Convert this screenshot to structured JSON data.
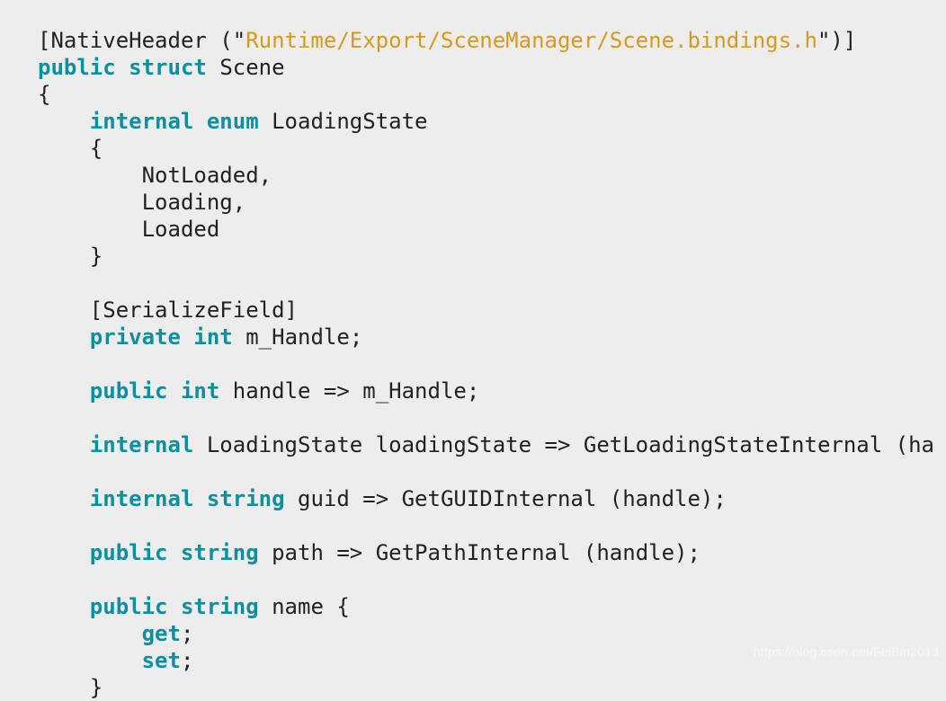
{
  "code": {
    "l1": {
      "a": "[NativeHeader (\"",
      "b": "Runtime/Export/SceneManager/Scene.bindings.h",
      "c": "\")]"
    },
    "l2": {
      "mod": "public",
      "kw": "struct",
      "name": "Scene"
    },
    "l3": "{",
    "l4": {
      "mod": "internal",
      "kw": "enum",
      "name": "LoadingState"
    },
    "l5": "{",
    "l6": "NotLoaded,",
    "l7": "Loading,",
    "l8": "Loaded",
    "l9": "}",
    "l10": "[SerializeField]",
    "l11": {
      "mod": "private",
      "typ": "int",
      "rest": "m_Handle;"
    },
    "l12": {
      "mod": "public",
      "typ": "int",
      "rest": "handle => m_Handle;"
    },
    "l13": {
      "mod": "internal",
      "rest": "LoadingState loadingState => GetLoadingStateInternal (ha"
    },
    "l14": {
      "mod": "internal",
      "typ": "string",
      "rest": "guid => GetGUIDInternal (handle);"
    },
    "l15": {
      "mod": "public",
      "typ": "string",
      "rest": "path => GetPathInternal (handle);"
    },
    "l16": {
      "mod": "public",
      "typ": "string",
      "rest": "name {"
    },
    "l17": {
      "acc": "get",
      "semi": ";"
    },
    "l18": {
      "acc": "set",
      "semi": ";"
    },
    "l19": "}"
  },
  "watermark": "https://blog.csdn.net/FeiBin2013"
}
